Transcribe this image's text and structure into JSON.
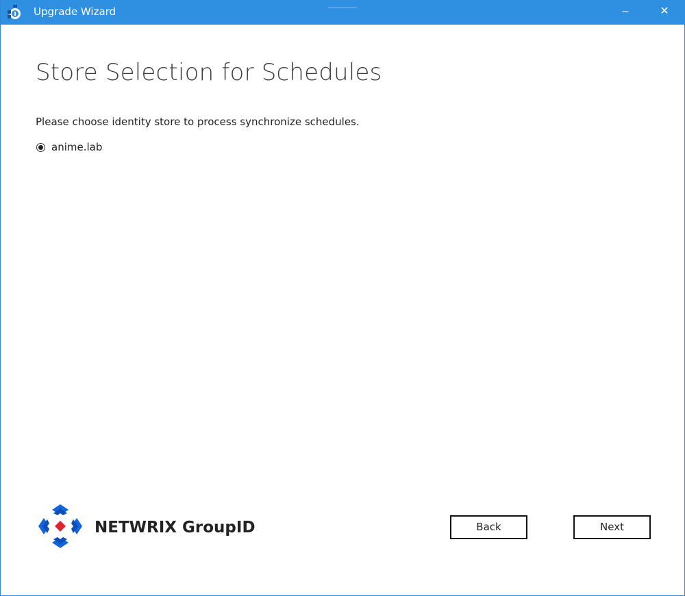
{
  "window": {
    "title": "Upgrade Wizard",
    "minimize_glyph": "–",
    "close_glyph": "✕",
    "colors": {
      "titlebar": "#2f8fe0"
    }
  },
  "main": {
    "heading": "Store Selection for Schedules",
    "instruction": "Please choose identity store to process synchronize schedules.",
    "stores": [
      {
        "label": "anime.lab",
        "selected": true
      }
    ]
  },
  "footer": {
    "brand": "NETWRIX GroupID",
    "back_label": "Back",
    "next_label": "Next",
    "colors": {
      "logo_blue": "#1565d8",
      "logo_red": "#d8262f"
    }
  }
}
